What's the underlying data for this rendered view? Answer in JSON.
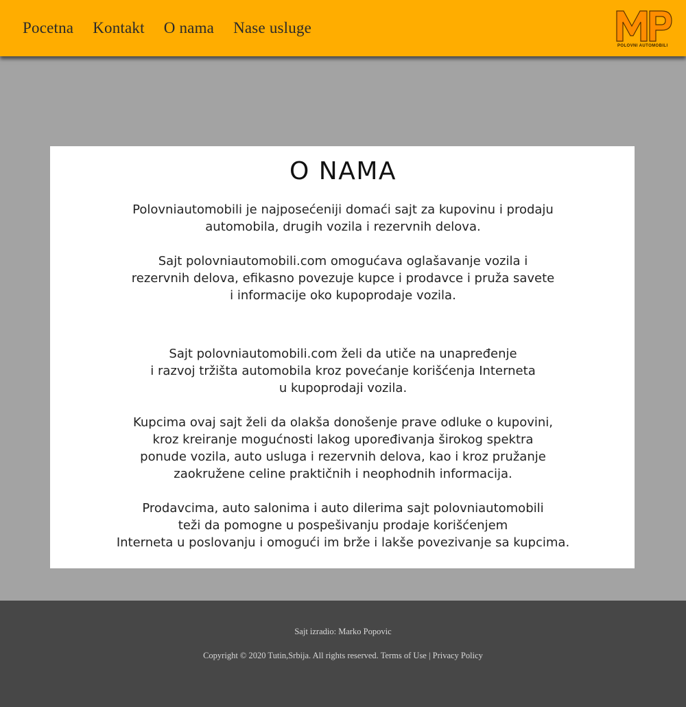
{
  "header": {
    "nav": [
      {
        "label": "Pocetna"
      },
      {
        "label": "Kontakt"
      },
      {
        "label": "O nama"
      },
      {
        "label": "Nase usluge"
      }
    ],
    "logo": {
      "letters": "MP",
      "caption": "POLOVNI  AUTOMOBILI"
    }
  },
  "main": {
    "title": "O NAMA",
    "paragraphs": [
      "Polovniautomobili je najposećeniji domaći sajt za kupovinu i prodaju\nautomobila, drugih vozila i rezervnih delova.",
      "Sajt polovniautomobili.com omogućava oglašavanje vozila i\nrezervnih delova, efikasno povezuje kupce i prodavce i pruža savete\ni informacije oko kupoprodaje vozila.",
      "Sajt polovniautomobili.com želi da utiče na unapređenje\ni razvoj tržišta automobila kroz povećanje korišćenja Interneta\nu kupoprodaji vozila.",
      "Kupcima ovaj sajt želi da olakša donošenje prave odluke o kupovini,\nkroz kreiranje mogućnosti lakog upoređivanja širokog spektra\nponude vozila, auto usluga i rezervnih delova, kao i kroz pružanje\nzaokružene celine praktičnih i neophodnih informacija.",
      "Prodavcima, auto salonima i auto dilerima sajt polovniautomobili\nteži da pomogne u pospešivanju prodaje korišćenjem\nInterneta u poslovanju i omogući im brže i lakše povezivanje sa kupcima."
    ]
  },
  "footer": {
    "credit": "Sajt izradio: Marko Popovic",
    "copyright": "Copyright © 2020 Tutin,Srbija. All rights reserved.",
    "terms": "Terms of Use",
    "separator": "|",
    "privacy": "Privacy Policy"
  },
  "colors": {
    "header_bg": "#ffad00",
    "page_bg": "#a3a3a3",
    "card_bg": "#ffffff",
    "footer_bg": "#474747",
    "logo_orange": "#ff8c00"
  }
}
